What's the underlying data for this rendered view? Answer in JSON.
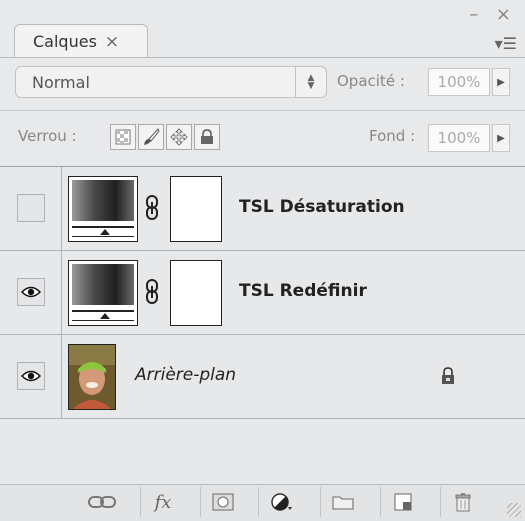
{
  "panel": {
    "tab_label": "Calques",
    "tab_close": "×",
    "window_controls": "– ×",
    "menu_icon": "▾☰"
  },
  "blend": {
    "mode": "Normal",
    "opacity_label": "Opacité :",
    "opacity_value": "100%"
  },
  "lock": {
    "label": "Verrou :",
    "fill_label": "Fond :",
    "fill_value": "100%",
    "icons": [
      "lock-transparent-icon",
      "lock-brush-icon",
      "lock-move-icon",
      "lock-all-icon"
    ]
  },
  "layers": [
    {
      "name": "TSL Désaturation",
      "visible": false,
      "type": "adjustment"
    },
    {
      "name": "TSL Redéfinir",
      "visible": true,
      "type": "adjustment"
    },
    {
      "name": "Arrière-plan",
      "visible": true,
      "type": "image",
      "locked": true
    }
  ],
  "bottom_icons": [
    "link-icon",
    "fx-icon",
    "mask-icon",
    "adjustment-icon",
    "folder-icon",
    "new-layer-icon",
    "trash-icon"
  ],
  "bottom_fx_text": "fx"
}
